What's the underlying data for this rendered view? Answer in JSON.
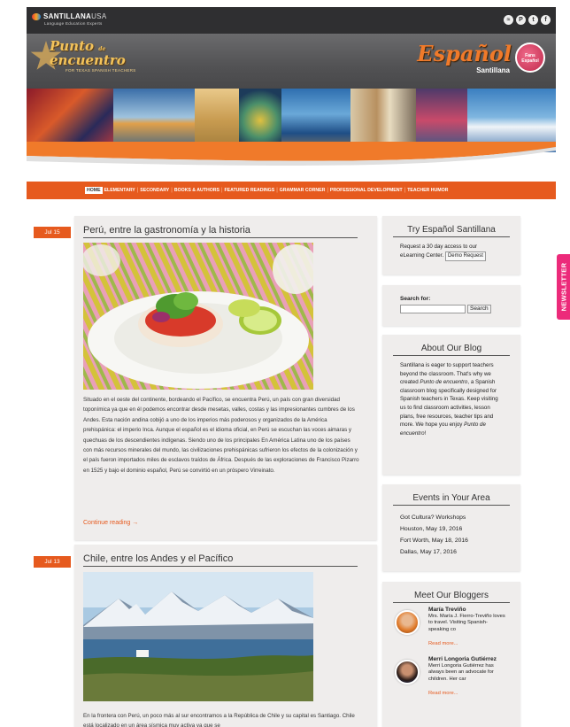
{
  "topbar": {
    "logo_brand": "SANTILLANA",
    "logo_usa": "USA",
    "logo_tagline": "Language Education Experts",
    "social_icons": [
      "rss-icon",
      "pinterest-icon",
      "twitter-icon",
      "facebook-icon"
    ]
  },
  "header": {
    "brand_title_line1": "Punto",
    "brand_title_de": "de",
    "brand_title_line2": "encuentro",
    "brand_sub": "FOR TEXAS SPANISH TEACHERS",
    "espanol": "Español",
    "santillana": "Santillana",
    "badge_line1": "Fans",
    "badge_line2": "Español"
  },
  "nav": {
    "items": [
      "HOME",
      "ELEMENTARY",
      "SECONDARY",
      "BOOKS & AUTHORS",
      "FEATURED READINGS",
      "GRAMMAR CORNER",
      "PROFESSIONAL DEVELOPMENT",
      "TEACHER HUMOR"
    ],
    "active": "HOME"
  },
  "posts": [
    {
      "date": "Jul 15",
      "title": "Perú, entre la gastronomía y la historia",
      "body_1": "Situado en el oeste del continente, bordeando el Pacífico, se encuentra Perú, un país con gran diversidad toponímica ya que en él podemos encontrar desde mesetas, valles, costas y las impresionantes cumbres de los Andes. Esta nación andina cobijó a uno de los imperios más poderosos y organizados de la América prehispánica: el imperio Inca. Aunque el español es el idioma oficial, en Perú se escuchan las voces aimaras y quechuas de los descendientes indígenas. Siendo uno de los principales En América Latina uno de los países con más recursos minerales del mundo, las civilizaciones prehispánicas sufrieron los efectos de la colonización y el país fueron importados miles de esclavos traídos de África. Después de las exploraciones de Francisco Pizarro en 1525 y bajo el dominio español, Perú se convirtió en un próspero Virreinato.",
      "continue": "Continue reading →"
    },
    {
      "date": "Jul 13",
      "title": "Chile, entre los Andes y el Pacífico",
      "body_1": "En la frontera con Perú, un poco más al sur encontramos a la República de Chile y su capital es Santiago. Chile está localizado en un área sísmica muy activa ya que se"
    }
  ],
  "sidebar": {
    "try": {
      "title": "Try Español Santillana",
      "text": "Request a 30 day access to our eLearning Center.",
      "button": "Demo Request"
    },
    "search": {
      "label": "Search for:",
      "button": "Search",
      "value": ""
    },
    "about": {
      "title": "About Our Blog",
      "text_1": "Santillana is eager to support teachers beyond the classroom. That's why we created ",
      "em_1": "Punto de encuentro",
      "text_2": ", a Spanish classroom blog specifically designed for Spanish teachers in Texas. Keep visiting us to find classroom activities, lesson plans, free resources, teacher tips and more. We hope you enjoy ",
      "em_2": "Punto de encuentro",
      "text_3": "!"
    },
    "events": {
      "title": "Events in Your Area",
      "items": [
        "Got Cultura? Workshops",
        "Houston, May 19, 2016",
        "Fort Worth, May 18, 2016",
        "Dallas, May 17, 2016"
      ]
    },
    "bloggers": {
      "title": "Meet Our Bloggers",
      "items": [
        {
          "name": "María Treviño",
          "bio": "Mrs. María J. Fierro-Treviño loves to travel. Visiting Spanish-speaking co",
          "more": "Read more..."
        },
        {
          "name": "Merri Longoria Gutiérrez",
          "bio": "Merri Longoria Gutiérrez has always been an advocate for children. Her car",
          "more": "Read more..."
        }
      ]
    }
  },
  "newsletter": "NEWSLETTER",
  "colors": {
    "accent": "#e65a1e",
    "topbar": "#2f2f31",
    "panel": "#efedec",
    "newsletter": "#ec2a7a"
  }
}
